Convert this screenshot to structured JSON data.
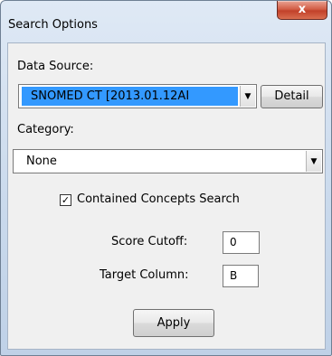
{
  "window": {
    "title": "Search Options",
    "close_label": "x"
  },
  "data_source": {
    "label": "Data Source:",
    "value": "SNOMED CT [2013.01.12AI",
    "detail_button": "Detail"
  },
  "category": {
    "label": "Category:",
    "value": "None"
  },
  "contained_concepts": {
    "label": "Contained Concepts Search",
    "checked": true,
    "check_mark": "✓"
  },
  "score_cutoff": {
    "label": "Score Cutoff:",
    "value": "0"
  },
  "target_column": {
    "label": "Target Column:",
    "value": "B"
  },
  "apply_button": "Apply",
  "icons": {
    "dropdown_arrow": "▼"
  }
}
